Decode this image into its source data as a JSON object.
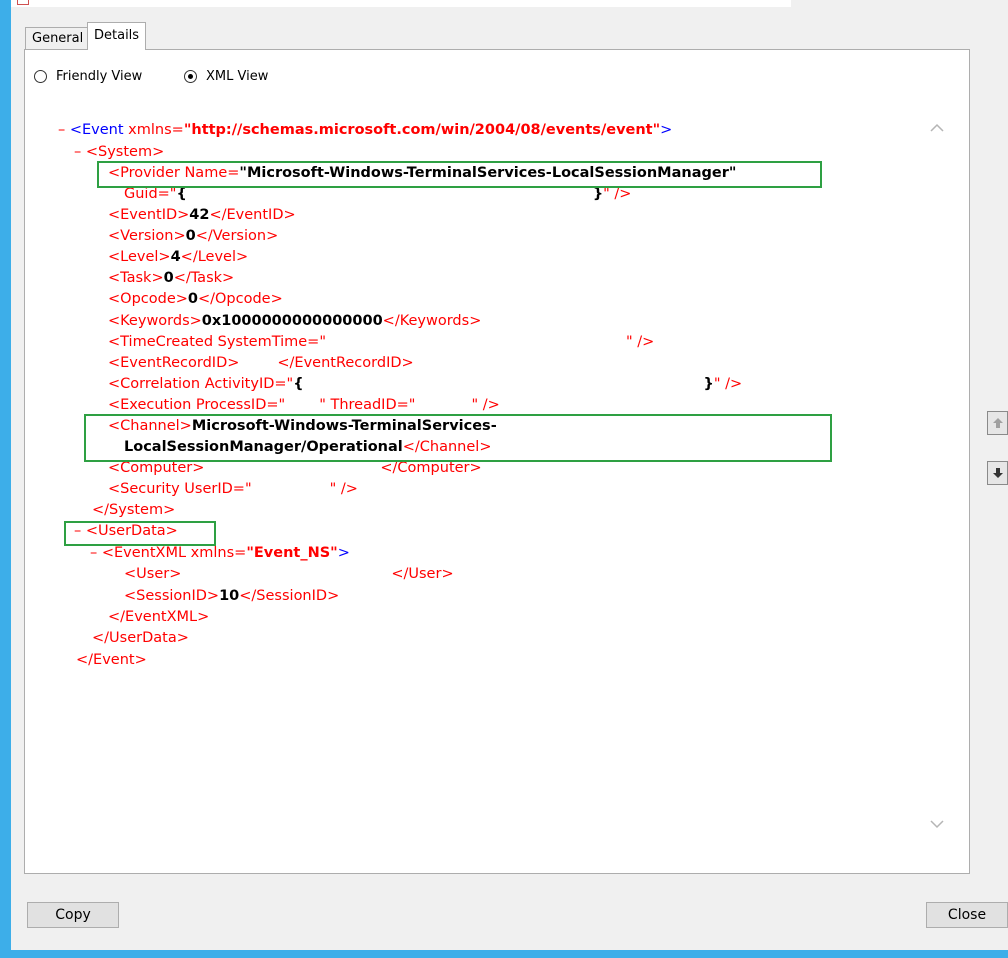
{
  "tabs": [
    {
      "label": "General",
      "selected": false
    },
    {
      "label": "Details",
      "selected": true
    }
  ],
  "view_options": {
    "friendly_label": "Friendly View",
    "xml_label": "XML View",
    "selected": "XML View"
  },
  "xml": {
    "dash": "–",
    "event_open": "<Event",
    "xmlns_attr": " xmlns=",
    "event_ns_value": "\"http://schemas.microsoft.com/win/2004/08/events/event\"",
    "gt": ">",
    "system_open": "<System>",
    "provider_open": "<Provider Name=",
    "provider_name": "\"Microsoft-Windows-TerminalServices-LocalSessionManager\"",
    "guid_attr": "Guid=\"",
    "guid_start": "{",
    "guid_end": "}",
    "guid_close": "\" />",
    "eventid_open": "<EventID>",
    "eventid_value": "42",
    "eventid_close": "</EventID>",
    "version_open": "<Version>",
    "version_value": "0",
    "version_close": "</Version>",
    "level_open": "<Level>",
    "level_value": "4",
    "level_close": "</Level>",
    "task_open": "<Task>",
    "task_value": "0",
    "task_close": "</Task>",
    "opcode_open": "<Opcode>",
    "opcode_value": "0",
    "opcode_close": "</Opcode>",
    "keywords_open": "<Keywords>",
    "keywords_value": "0x1000000000000000",
    "keywords_close": "</Keywords>",
    "timecreated_open": "<TimeCreated SystemTime=\"",
    "timecreated_close": "\" />",
    "eventrecordid_open": "<EventRecordID>",
    "eventrecordid_close": "</EventRecordID>",
    "correlation_open": "<Correlation ActivityID=\"",
    "correlation_start": "{",
    "correlation_end": "}",
    "correlation_close": "\" />",
    "execution_open": "<Execution ProcessID=\"",
    "execution_mid": "\" ThreadID=\"",
    "execution_close": "\" />",
    "channel_open": "<Channel>",
    "channel_value_1": "Microsoft-Windows-TerminalServices-",
    "channel_value_2": "LocalSessionManager/Operational",
    "channel_close": "</Channel>",
    "computer_open": "<Computer>",
    "computer_close": "</Computer>",
    "security_open": "<Security UserID=\"",
    "security_close": "\" />",
    "system_close": "</System>",
    "userdata_open": "<UserData>",
    "eventxml_open": "<EventXML",
    "eventxml_ns_value": "\"Event_NS\"",
    "user_open": "<User>",
    "user_close": "</User>",
    "sessionid_open": "<SessionID>",
    "sessionid_value": "10",
    "sessionid_close": "</SessionID>",
    "eventxml_close": "</EventXML>",
    "userdata_close": "</UserData>",
    "event_close": "</Event>"
  },
  "buttons": {
    "copy_label": "Copy",
    "close_label": "Close"
  },
  "colors": {
    "frame": "#3daee9",
    "tag": "#7a0000",
    "bracket": "#0000ff",
    "attr_value": "#ff0000",
    "highlight_box": "#2ea043"
  }
}
